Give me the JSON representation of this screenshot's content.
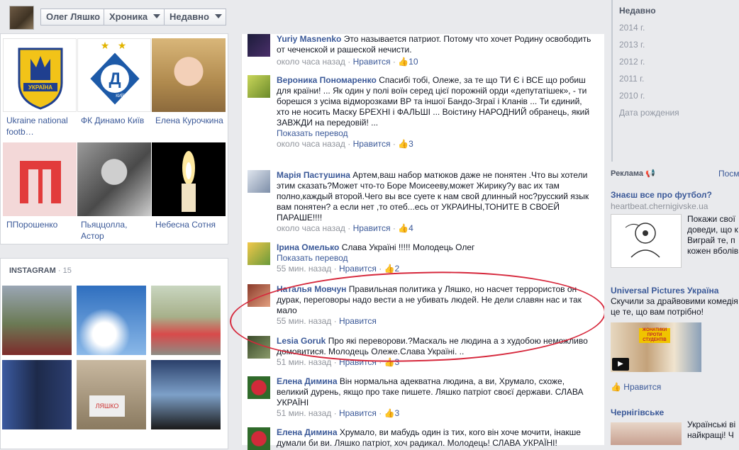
{
  "header": {
    "profile_name": "Олег Ляшко",
    "timeline_label": "Хроника",
    "recent_label": "Недавно"
  },
  "likes_grid": [
    {
      "caption": "Ukraine national footb…"
    },
    {
      "caption": "ФК Динамо Київ"
    },
    {
      "caption": "Елена Курочкина"
    },
    {
      "caption": "ППорошенко"
    },
    {
      "caption": "Пьяццолла, Астор"
    },
    {
      "caption": "Небесна Сотня"
    }
  ],
  "logos": {
    "ukraine_badge_text": "УКРАЇНА",
    "dynamo_letter": "Д",
    "dynamo_city": "КИЇВ"
  },
  "instagram": {
    "title": "INSTAGRAM",
    "count": "· 15",
    "sign_text": "ЛЯШКО"
  },
  "comments": [
    {
      "name": "Yuriy Masnenko",
      "text": "Это называется патриот. Потому что хочет Родину освободить от чеченской и рашеской нечисти.",
      "translate": "",
      "time": "около часа назад",
      "like": "Нравится",
      "likes": "10"
    },
    {
      "name": "Вероника Пономаренко",
      "text": "Спасибі тобі, Олеже, за те що ТИ Є і ВСЕ що робиш для країни! ... Як один у полі воїн серед цієї порожній орди «депутатішек», - ти борешся з усіма відморозками ВР та іншої Бандо-Зграї і Кланів ... Ти єдиний, хто не носить Маску БРЕХНІ і ФАЛЬШІ ... Воістину НАРОДНИЙ обранець, який ЗАВЖДИ на передовій! ...",
      "translate": "Показать перевод",
      "time": "около часа назад",
      "like": "Нравится",
      "likes": "3"
    },
    {
      "name": "Марія Пастушина",
      "text": "Артем,ваш набор матюков даже не понятен .Что вы хотели этим сказать?Может что-то Боре Моисееву,может Жирику?у вас их там полно,каждый второй.Чего вы все суете к нам свой длинный нос?русский язык вам понятен? а если нет ,то отеб...есь от УКРАИНЫ,ТОНИТЕ В СВОЕЙ ПАРАШЕ!!!!",
      "translate": "",
      "time": "около часа назад",
      "like": "Нравится",
      "likes": "4"
    },
    {
      "name": "Ірина Омелько",
      "text": "Слава Україні !!!!! Молодець Олег",
      "translate": "Показать перевод",
      "time": "55 мин. назад",
      "like": "Нравится",
      "likes": "2"
    },
    {
      "name": "Наталья Мовчун",
      "text": "Правильная политика у Ляшко, но насчет террористов он дурак, переговоры надо вести а не убивать людей. Не дели славян нас и так мало",
      "translate": "",
      "time": "55 мин. назад",
      "like": "Нравится",
      "likes": ""
    },
    {
      "name": "Lesia Goruk",
      "text": "Про які перевoрови.?Маскаль не людина а з худобою неможливо домовитися. Молодець Олеже.Слава Україні. ..",
      "translate": "",
      "time": "51 мин. назад",
      "like": "Нравится",
      "likes": "3"
    },
    {
      "name": "Елена Димина",
      "text": "Він нормальна адекватна людина, а ви, Хрумало, схоже, великий дурень, якщо про таке пишете. Ляшко патріот своєї держави. СЛАВА УКРАЇНІ",
      "translate": "",
      "time": "51 мин. назад",
      "like": "Нравится",
      "likes": "3"
    },
    {
      "name": "Елена Димина",
      "text": "Хрумало, ви мабудь один із тих, кого він хоче мочити, інакше думали би ви. Ляшко патріот, хоч радикал. Молодець! СЛАВА УКРАЇНІ!",
      "translate": "",
      "time": "",
      "like": "",
      "likes": ""
    }
  ],
  "years": {
    "recent": "Недавно",
    "items": [
      "2014 г.",
      "2013 г.",
      "2012 г.",
      "2011 г.",
      "2010 г.",
      "Дата рождения"
    ]
  },
  "ads": {
    "heading": "Реклама",
    "more": "Посм",
    "ad1": {
      "title": "Знаєш все про футбол?",
      "url": "heartbeat.chernigivske.ua",
      "text": [
        "Покажи свої",
        "доведи, що к",
        "Виграй те, п",
        "кожен вболів"
      ]
    },
    "ad2": {
      "title": "Universal Pictures Україна",
      "text": [
        "Скучили за драйвовими комедія",
        "це те, що вам потрібно!"
      ],
      "poster_line1": "ЖОНАТИКИ",
      "poster_line2": "ПРОТИ",
      "poster_line3": "СТУДЕНТІВ",
      "like": "Нравится"
    },
    "ad3": {
      "title": "Чернігівське",
      "text": [
        "Українські ві",
        "найкращі! Ч"
      ]
    }
  },
  "colors": {
    "link": "#3b5998",
    "meta": "#90949c",
    "highlight": "#d6283c"
  }
}
